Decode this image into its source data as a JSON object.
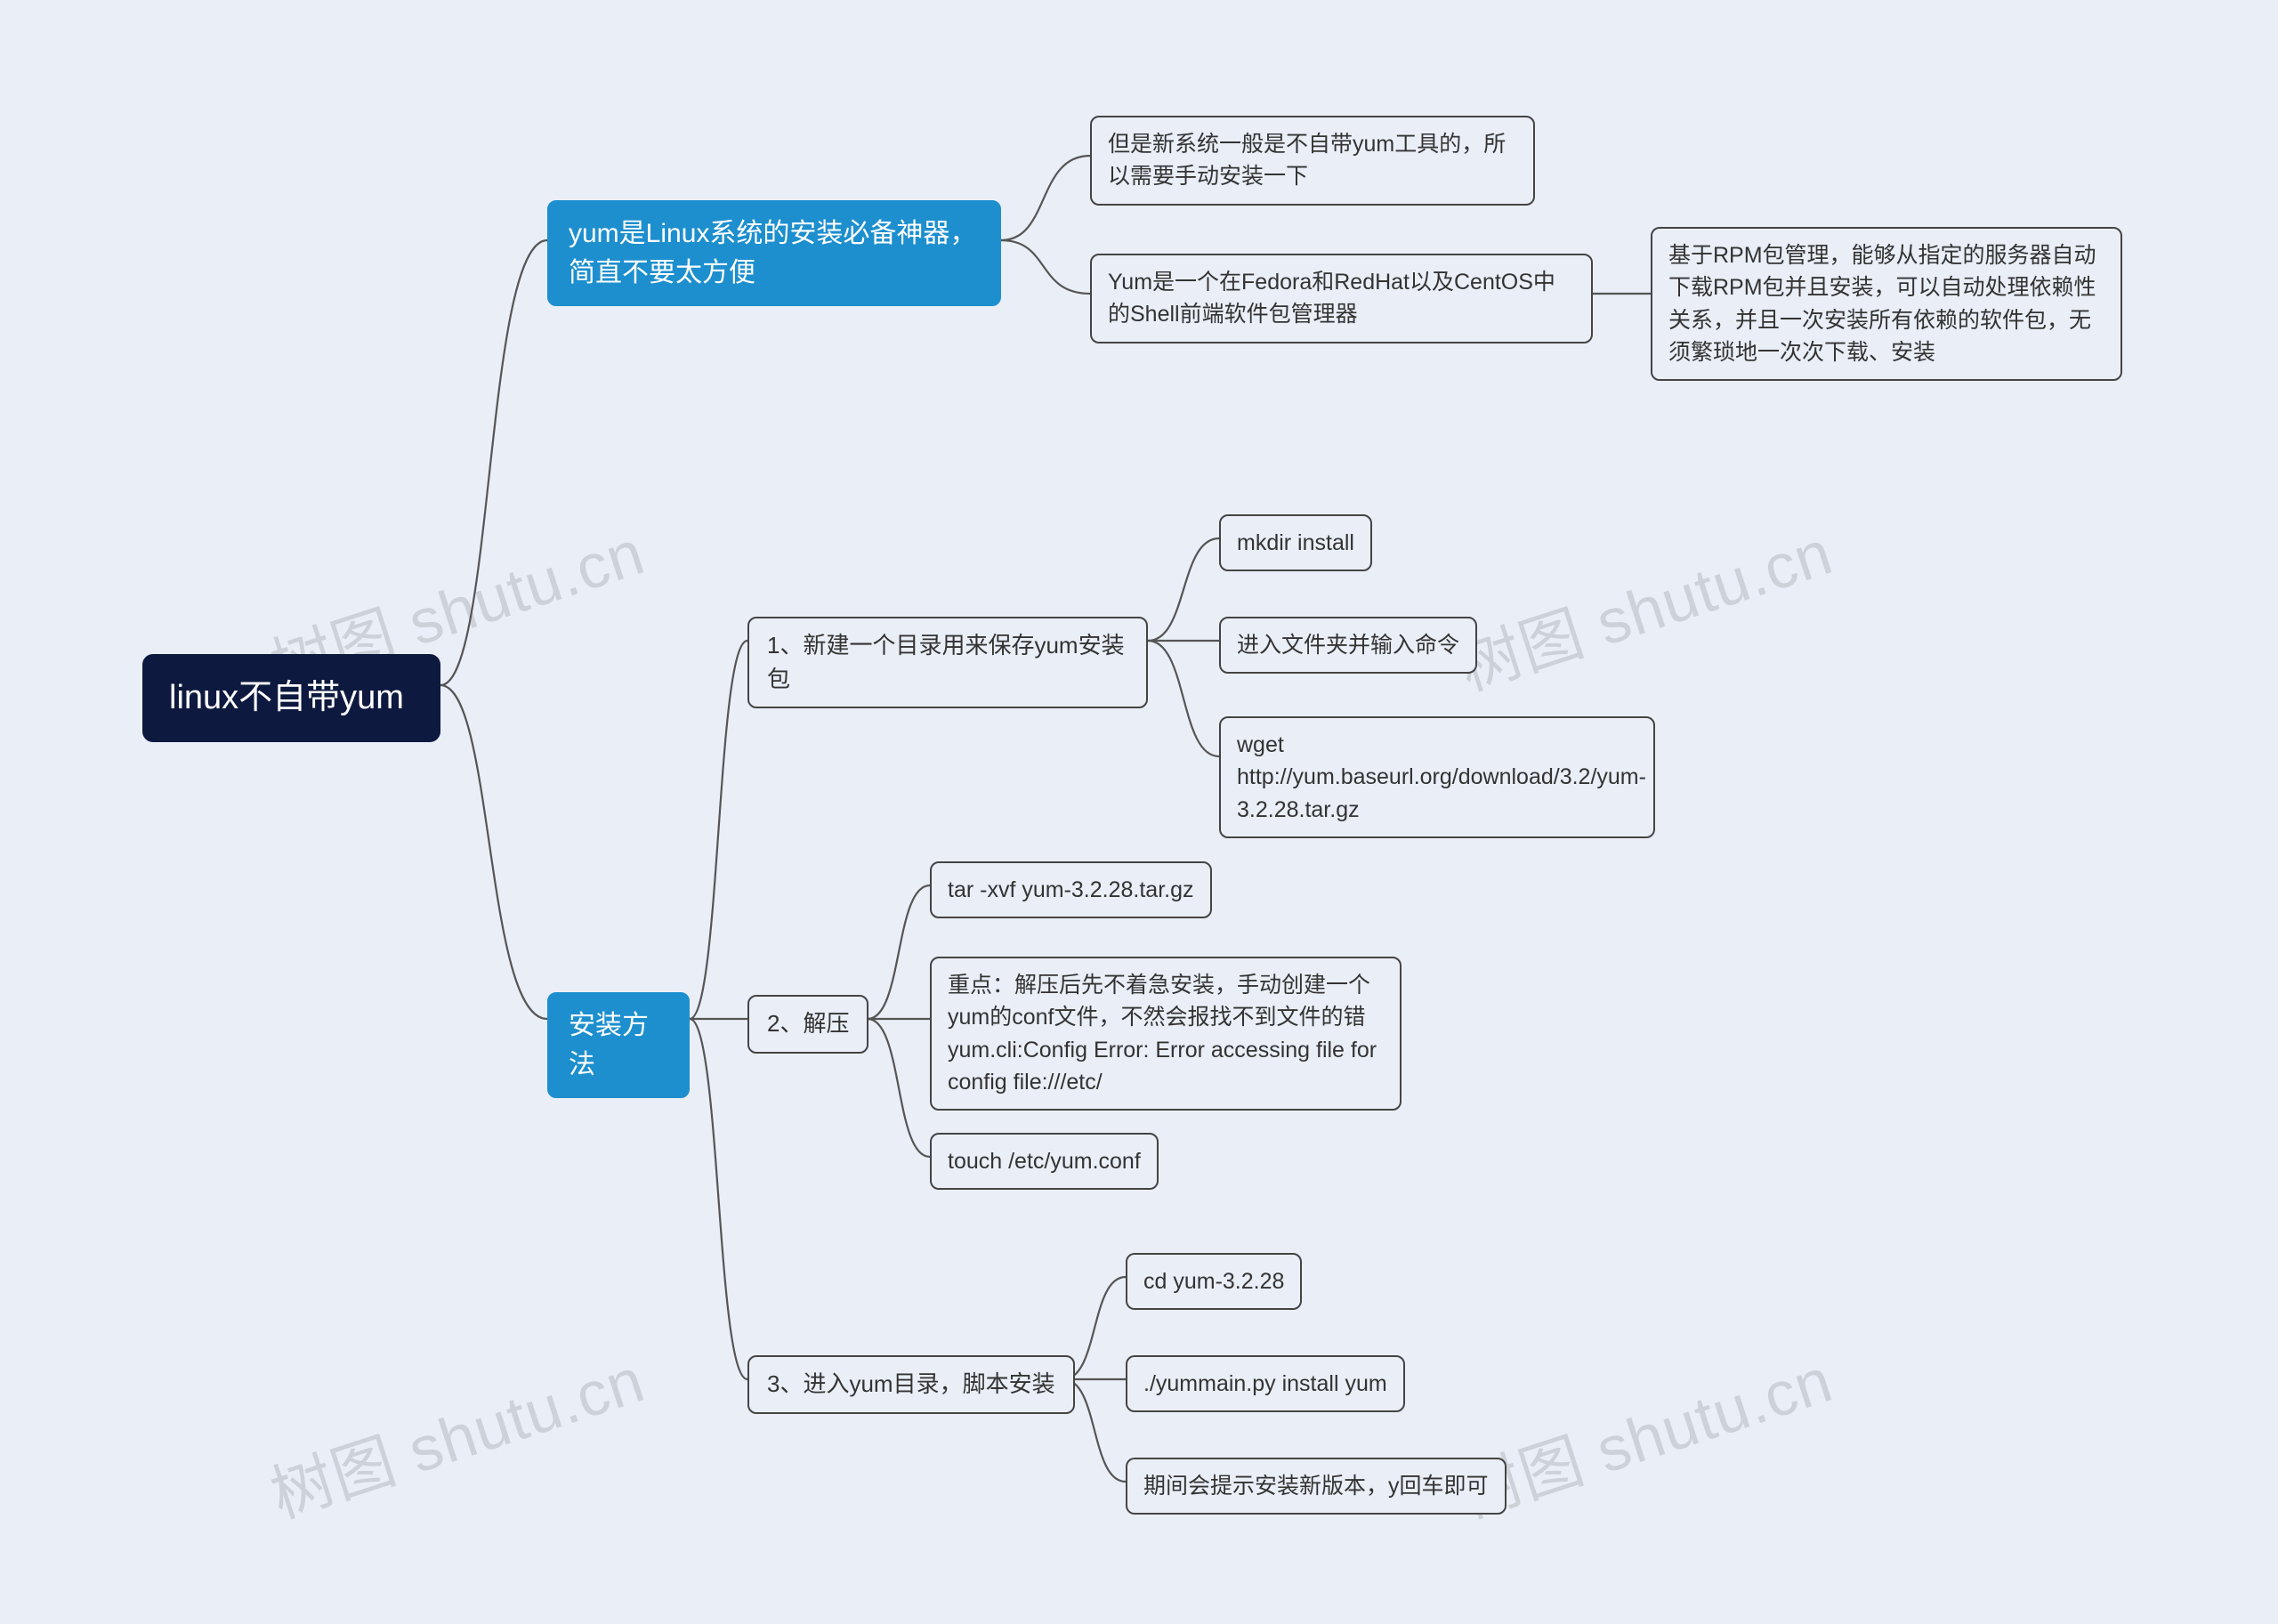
{
  "chart_data": {
    "type": "mindmap",
    "root": "linux不自带yum",
    "children": [
      {
        "label": "yum是Linux系统的安装必备神器，简直不要太方便",
        "children": [
          {
            "label": "但是新系统一般是不自带yum工具的，所以需要手动安装一下"
          },
          {
            "label": "Yum是一个在Fedora和RedHat以及CentOS中的Shell前端软件包管理器",
            "children": [
              {
                "label": "基于RPM包管理，能够从指定的服务器自动下载RPM包并且安装，可以自动处理依赖性关系，并且一次安装所有依赖的软件包，无须繁琐地一次次下载、安装"
              }
            ]
          }
        ]
      },
      {
        "label": "安装方法",
        "children": [
          {
            "label": "1、新建一个目录用来保存yum安装包",
            "children": [
              {
                "label": "mkdir install"
              },
              {
                "label": "进入文件夹并输入命令"
              },
              {
                "label": "wget http://yum.baseurl.org/download/3.2/yum-3.2.28.tar.gz"
              }
            ]
          },
          {
            "label": "2、解压",
            "children": [
              {
                "label": "tar -xvf yum-3.2.28.tar.gz"
              },
              {
                "label": "重点：解压后先不着急安装，手动创建一个yum的conf文件，不然会报找不到文件的错yum.cli:Config Error: Error accessing file for config file:///etc/"
              },
              {
                "label": "touch /etc/yum.conf"
              }
            ]
          },
          {
            "label": "3、进入yum目录，脚本安装",
            "children": [
              {
                "label": "cd yum-3.2.28"
              },
              {
                "label": "./yummain.py install yum"
              },
              {
                "label": "期间会提示安装新版本，y回车即可"
              }
            ]
          }
        ]
      }
    ]
  },
  "root": {
    "label": "linux不自带yum"
  },
  "b1": {
    "label": "yum是Linux系统的安装必备神器，简直不要太方便"
  },
  "b1a": {
    "label": "但是新系统一般是不自带yum工具的，所以需要手动安装一下"
  },
  "b1b": {
    "label": "Yum是一个在Fedora和RedHat以及CentOS中的Shell前端软件包管理器"
  },
  "b1b1": {
    "label": "基于RPM包管理，能够从指定的服务器自动下载RPM包并且安装，可以自动处理依赖性关系，并且一次安装所有依赖的软件包，无须繁琐地一次次下载、安装"
  },
  "b2": {
    "label": "安装方法"
  },
  "s1": {
    "label": "1、新建一个目录用来保存yum安装包"
  },
  "s1a": {
    "label": "mkdir install"
  },
  "s1b": {
    "label": "进入文件夹并输入命令"
  },
  "s1c": {
    "label": "wget http://yum.baseurl.org/download/3.2/yum-3.2.28.tar.gz"
  },
  "s2": {
    "label": "2、解压"
  },
  "s2a": {
    "label": "tar -xvf yum-3.2.28.tar.gz"
  },
  "s2b": {
    "label": "重点：解压后先不着急安装，手动创建一个yum的conf文件，不然会报找不到文件的错yum.cli:Config Error: Error accessing file for config file:///etc/"
  },
  "s2c": {
    "label": "touch /etc/yum.conf"
  },
  "s3": {
    "label": "3、进入yum目录，脚本安装"
  },
  "s3a": {
    "label": "cd yum-3.2.28"
  },
  "s3b": {
    "label": "./yummain.py install yum"
  },
  "s3c": {
    "label": "期间会提示安装新版本，y回车即可"
  },
  "watermark": {
    "text": "树图 shutu.cn"
  }
}
